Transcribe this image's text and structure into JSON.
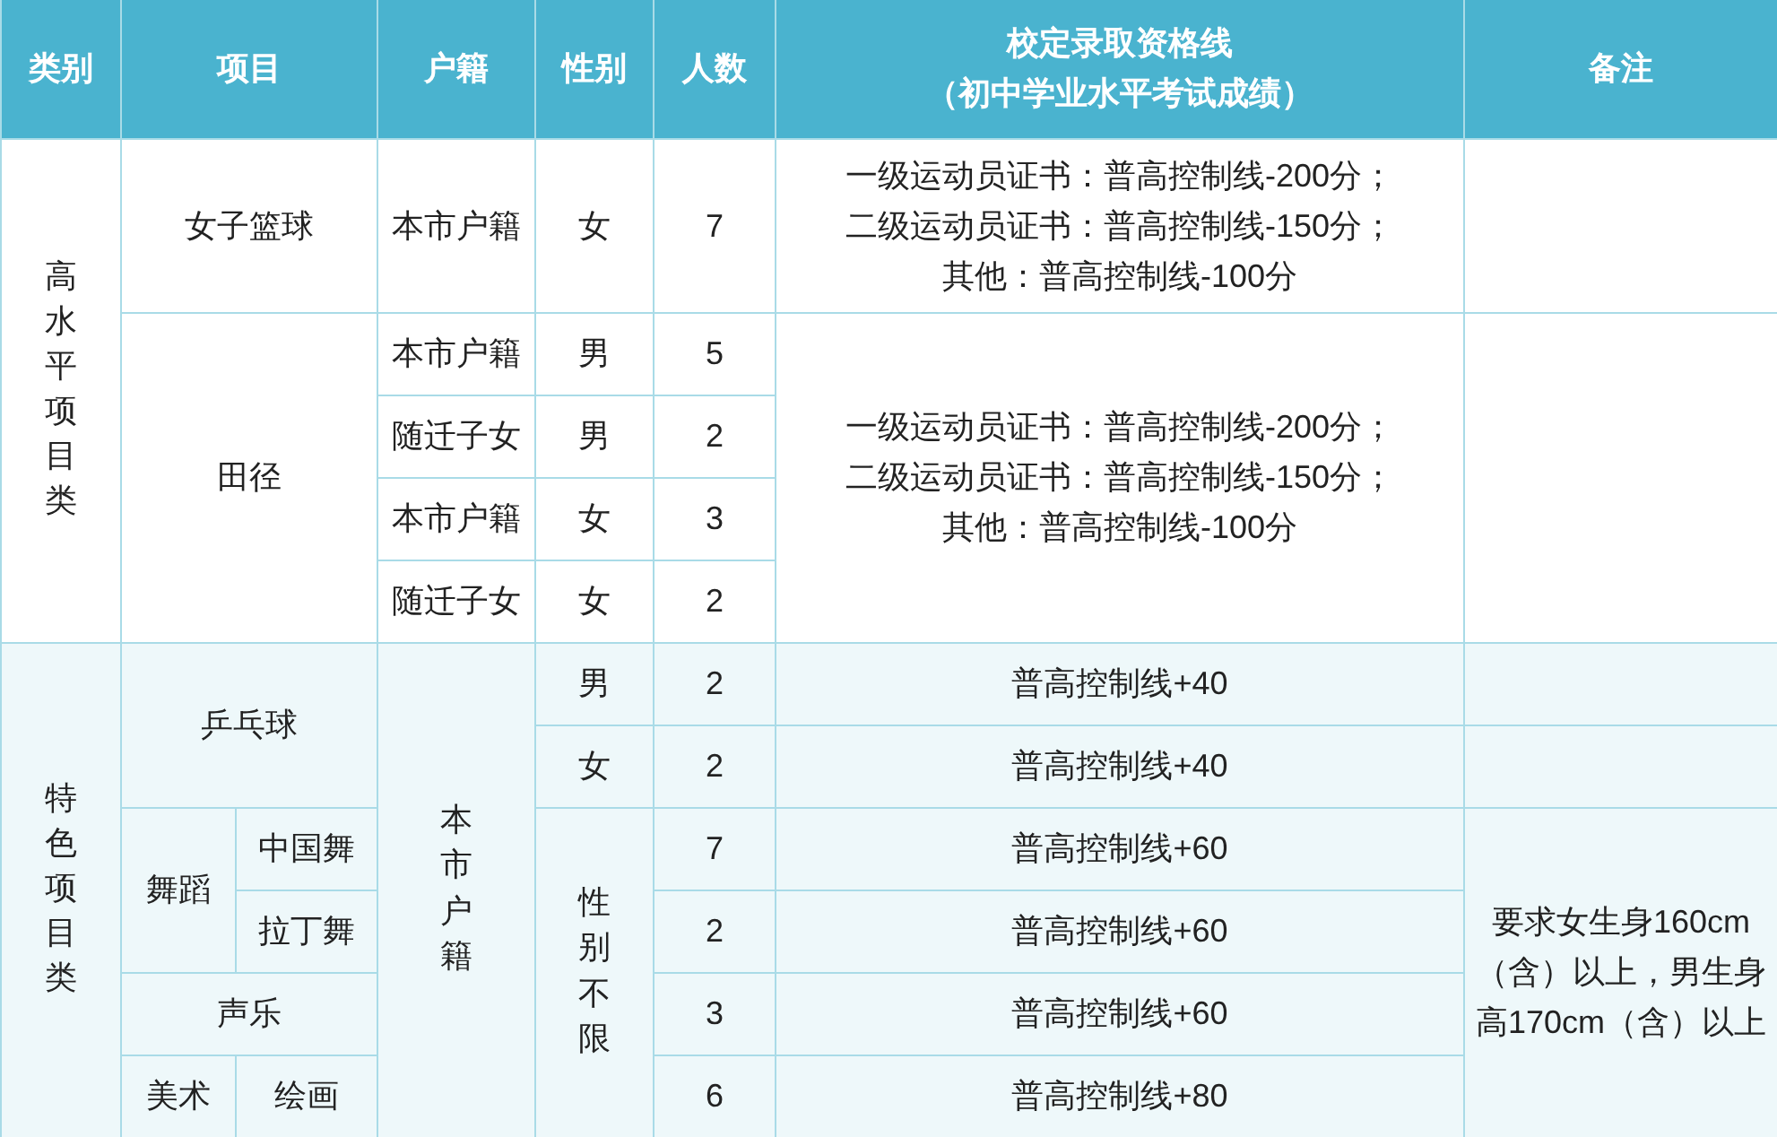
{
  "table": {
    "header": [
      {
        "text": "类别"
      },
      {
        "text": "项目",
        "colspan": 2
      },
      {
        "text": "户籍"
      },
      {
        "text": "性别"
      },
      {
        "text": "人数"
      },
      {
        "lines": [
          "校定录取资格线",
          "（初中学业水平考试成绩）"
        ]
      },
      {
        "text": "备注"
      }
    ],
    "sections": [
      {
        "rows": [
          [
            {
              "text": "高水平项目类",
              "rowspan": 5,
              "kind": "vertical"
            },
            {
              "text": "女子篮球",
              "colspan": 2,
              "kind": "text"
            },
            {
              "text": "本市户籍",
              "kind": "text"
            },
            {
              "text": "女",
              "kind": "text"
            },
            {
              "text": "7",
              "kind": "text"
            },
            {
              "lines": [
                "一级运动员证书：普高控制线-200分；",
                "二级运动员证书：普高控制线-150分；",
                "其他：普高控制线-100分"
              ],
              "kind": "lines"
            },
            {}
          ],
          [
            {
              "text": "田径",
              "colspan": 2,
              "rowspan": 4,
              "kind": "text"
            },
            {
              "text": "本市户籍",
              "kind": "text"
            },
            {
              "text": "男",
              "kind": "text"
            },
            {
              "text": "5",
              "kind": "text"
            },
            {
              "lines": [
                "一级运动员证书：普高控制线-200分；",
                "二级运动员证书：普高控制线-150分；",
                "其他：普高控制线-100分"
              ],
              "rowspan": 4,
              "kind": "lines"
            },
            {
              "rowspan": 4
            }
          ],
          [
            {
              "text": "随迁子女",
              "kind": "text"
            },
            {
              "text": "男",
              "kind": "text"
            },
            {
              "text": "2",
              "kind": "text"
            }
          ],
          [
            {
              "text": "本市户籍",
              "kind": "text"
            },
            {
              "text": "女",
              "kind": "text"
            },
            {
              "text": "3",
              "kind": "text"
            }
          ],
          [
            {
              "text": "随迁子女",
              "kind": "text"
            },
            {
              "text": "女",
              "kind": "text"
            },
            {
              "text": "2",
              "kind": "text"
            }
          ]
        ]
      },
      {
        "rows": [
          [
            {
              "text": "特色项目类",
              "rowspan": 6,
              "kind": "vertical"
            },
            {
              "text": "乒乓球",
              "colspan": 2,
              "rowspan": 2,
              "kind": "text"
            },
            {
              "text": "本市户籍",
              "rowspan": 6,
              "kind": "vertical"
            },
            {
              "text": "男",
              "kind": "text"
            },
            {
              "text": "2",
              "kind": "text"
            },
            {
              "text": "普高控制线+40",
              "kind": "text"
            },
            {}
          ],
          [
            {
              "text": "女",
              "kind": "text"
            },
            {
              "text": "2",
              "kind": "text"
            },
            {
              "text": "普高控制线+40",
              "kind": "text"
            },
            {}
          ],
          [
            {
              "text": "舞蹈",
              "rowspan": 2,
              "kind": "text"
            },
            {
              "text": "中国舞",
              "kind": "text"
            },
            {
              "text": "性别不限",
              "rowspan": 4,
              "kind": "vertical"
            },
            {
              "text": "7",
              "kind": "text"
            },
            {
              "text": "普高控制线+60",
              "kind": "text"
            },
            {
              "text": "要求女生身160cm（含）以上，男生身高170cm（含）以上",
              "rowspan": 4,
              "kind": "text"
            }
          ],
          [
            {
              "text": "拉丁舞",
              "kind": "text"
            },
            {
              "text": "2",
              "kind": "text"
            },
            {
              "text": "普高控制线+60",
              "kind": "text"
            }
          ],
          [
            {
              "text": "声乐",
              "colspan": 2,
              "kind": "text"
            },
            {
              "text": "3",
              "kind": "text"
            },
            {
              "text": "普高控制线+60",
              "kind": "text"
            }
          ],
          [
            {
              "text": "美术",
              "kind": "text"
            },
            {
              "text": "绘画",
              "kind": "text"
            },
            {
              "text": "6",
              "kind": "text"
            },
            {
              "text": "普高控制线+80",
              "kind": "text"
            }
          ]
        ]
      }
    ]
  }
}
